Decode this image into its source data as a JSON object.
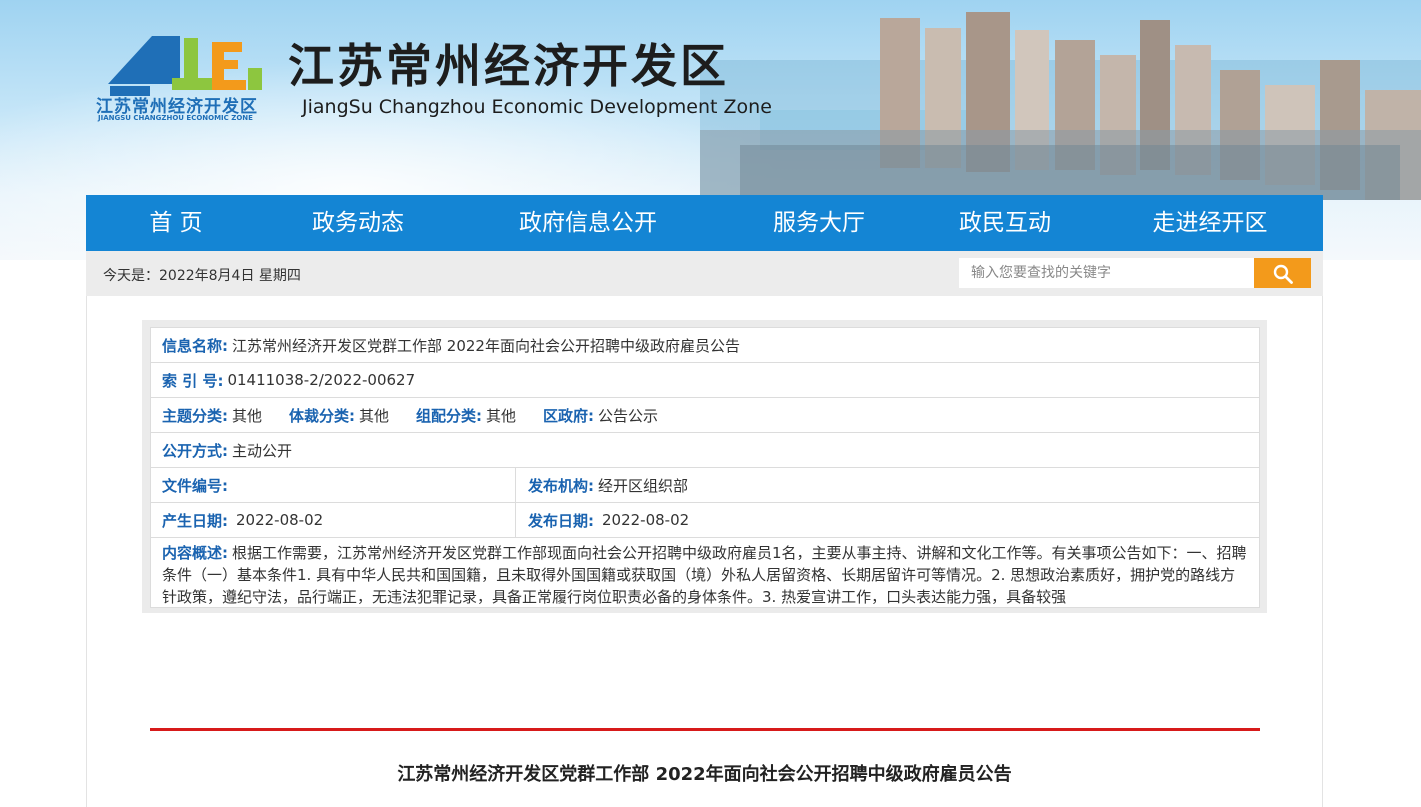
{
  "header": {
    "site_title": "江苏常州经济开发区",
    "site_subtitle": "JiangSu Changzhou Economic Development Zone",
    "logo_text_cn": "江苏常州经济开发区",
    "logo_text_en": "JIANGSU CHANGZHOU ECONOMIC ZONE",
    "colors": {
      "logo_blue": "#1f6fb7",
      "logo_green": "#8dc63f",
      "logo_orange": "#f39a1b"
    }
  },
  "nav": {
    "items": [
      {
        "label": "首 页"
      },
      {
        "label": "政务动态"
      },
      {
        "label": "政府信息公开"
      },
      {
        "label": "服务大厅"
      },
      {
        "label": "政民互动"
      },
      {
        "label": "走进经开区"
      }
    ],
    "color": "#1485d4"
  },
  "infobar": {
    "today_label": "今天是：",
    "today_value": "2022年8月4日 星期四",
    "search_placeholder": "输入您要查找的关键字",
    "search_icon": "search-icon"
  },
  "meta": {
    "info_name_label": "信息名称:",
    "info_name": "江苏常州经济开发区党群工作部 2022年面向社会公开招聘中级政府雇员公告",
    "index_label": "索 引 号:",
    "index_no": "01411038-2/2022-00627",
    "topic_label": "主题分类:",
    "topic": "其他",
    "genre_label": "体裁分类:",
    "genre": "其他",
    "org_label": "组配分类:",
    "org": "其他",
    "gov_label": "区政府:",
    "gov": "公告公示",
    "method_label": "公开方式:",
    "method": "主动公开",
    "doc_no_label": "文件编号:",
    "doc_no": "",
    "publisher_label": "发布机构:",
    "publisher": "经开区组织部",
    "created_label": "产生日期:",
    "created": "2022-08-02",
    "published_label": "发布日期:",
    "published": "2022-08-02",
    "summary_label": "内容概述:",
    "summary": "根据工作需要，江苏常州经济开发区党群工作部现面向社会公开招聘中级政府雇员1名，主要从事主持、讲解和文化工作等。有关事项公告如下：一、招聘条件（一）基本条件1. 具有中华人民共和国国籍，且未取得外国国籍或获取国（境）外私人居留资格、长期居留许可等情况。2. 思想政治素质好，拥护党的路线方针政策，遵纪守法，品行端正，无违法犯罪记录，具备正常履行岗位职责必备的身体条件。3. 热爱宣讲工作，口头表达能力强，具备较强"
  },
  "article": {
    "title": "江苏常州经济开发区党群工作部 2022年面向社会公开招聘中级政府雇员公告",
    "rule_color": "#d71a1a"
  }
}
